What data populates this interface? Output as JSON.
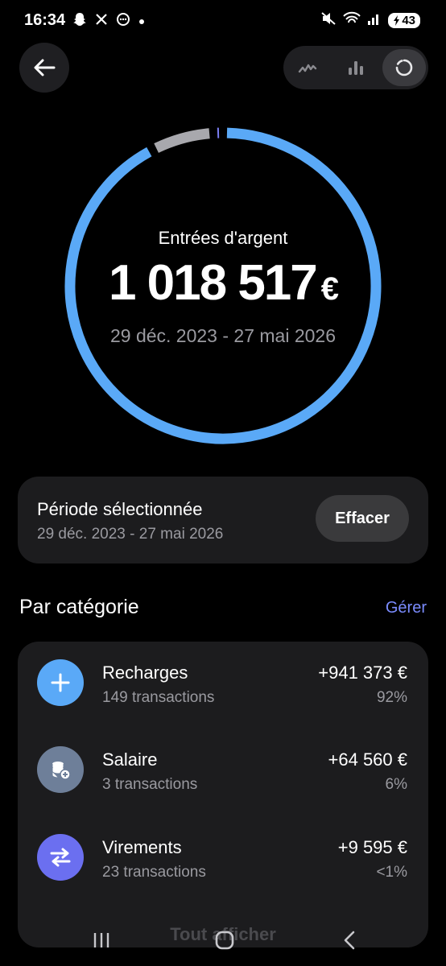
{
  "status_bar": {
    "time": "16:34",
    "battery": "43",
    "left_icons": [
      "snapchat-icon",
      "x-icon",
      "chat-icon",
      "dot-icon"
    ],
    "right_icons": [
      "mute-icon",
      "wifi-icon",
      "signal-icon",
      "battery-icon"
    ]
  },
  "header": {
    "back_icon": "arrow-left-icon",
    "view_options": [
      {
        "icon": "line-chart-icon",
        "active": false
      },
      {
        "icon": "bar-chart-icon",
        "active": false
      },
      {
        "icon": "donut-chart-icon",
        "active": true
      }
    ]
  },
  "summary": {
    "label": "Entrées d'argent",
    "amount": "1 018 517",
    "currency": "€",
    "range": "29 déc. 2023 - 27 mai 2026"
  },
  "donut": {
    "segments": [
      {
        "category": "Recharges",
        "share": 0.924,
        "color": "#5aa9f7"
      },
      {
        "category": "Salaire",
        "share": 0.066,
        "color": "#a8a8ad"
      },
      {
        "category": "Virements",
        "share": 0.01,
        "color": "#7b7ff5"
      }
    ]
  },
  "period": {
    "title": "Période sélectionnée",
    "range": "29 déc. 2023 - 27 mai 2026",
    "clear_label": "Effacer"
  },
  "categories": {
    "title": "Par catégorie",
    "manage_label": "Gérer",
    "items": [
      {
        "name": "Recharges",
        "count": "149 transactions",
        "amount": "+941 373 €",
        "percent": "92%",
        "icon": "plus-icon",
        "icon_bg": "#5aa9f7"
      },
      {
        "name": "Salaire",
        "count": "3 transactions",
        "amount": "+64 560 €",
        "percent": "6%",
        "icon": "coins-plus-icon",
        "icon_bg": "#6e7f99"
      },
      {
        "name": "Virements",
        "count": "23 transactions",
        "amount": "+9 595 €",
        "percent": "<1%",
        "icon": "transfer-arrows-icon",
        "icon_bg": "#6b6ff0"
      }
    ],
    "see_all_label": "Tout afficher"
  },
  "nav_bar": {
    "icons": [
      "recents-icon",
      "home-icon",
      "back-icon"
    ]
  }
}
